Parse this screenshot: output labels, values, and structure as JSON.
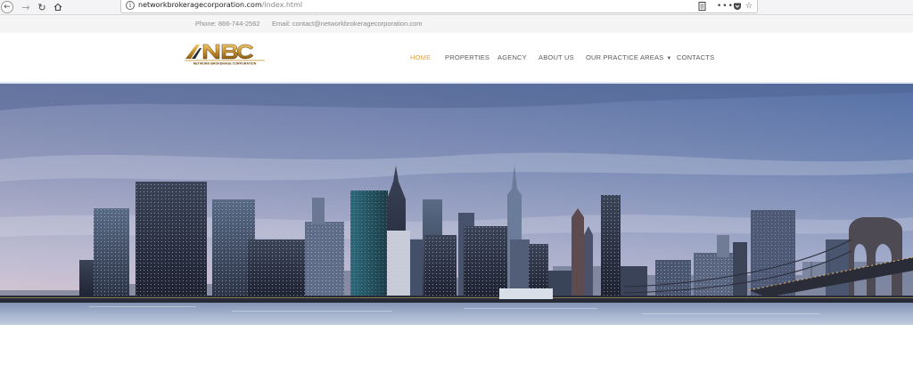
{
  "browser": {
    "url_host": "networkbrokeragecorporation.com",
    "url_path": "/index.html",
    "icons": [
      "back-arrow-icon",
      "forward-arrow-icon",
      "reload-icon",
      "home-icon",
      "info-icon",
      "reader-view-icon",
      "more-actions-icon",
      "pocket-icon",
      "bookmark-star-icon"
    ]
  },
  "topbar": {
    "phone": "Phone: 866-744-2562",
    "email": "Email: contact@networkbrokeragecorporation.com"
  },
  "logo": {
    "text": "NBC",
    "subtitle": "NETWORK BROKERAGE CORPORATION",
    "color": "#c9922e"
  },
  "nav": {
    "items": [
      {
        "label": "HOME",
        "active": true
      },
      {
        "label": "PROPERTIES",
        "active": false
      },
      {
        "label": "AGENCY",
        "active": false
      },
      {
        "label": "ABOUT US",
        "active": false
      },
      {
        "label": "OUR PRACTICE AREAS",
        "active": false,
        "dropdown": true
      },
      {
        "label": "CONTACTS",
        "active": false
      }
    ],
    "active_color": "#e0a24a"
  },
  "hero": {
    "image": "city-skyline-at-dusk",
    "sky_color": "#7f93bb",
    "water_color": "#9aabc7"
  }
}
